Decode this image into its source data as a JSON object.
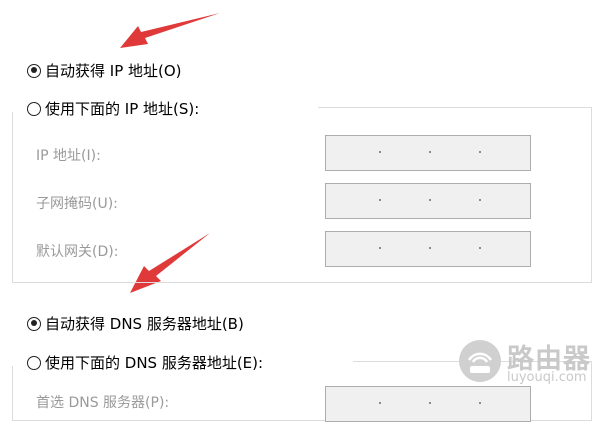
{
  "ip_section": {
    "auto_option": {
      "label": "自动获得 IP 地址(O)",
      "checked": true
    },
    "manual_option": {
      "label": "使用下面的 IP 地址(S):",
      "checked": false
    },
    "fields": [
      {
        "label": "IP 地址(I):",
        "value": ". . ."
      },
      {
        "label": "子网掩码(U):",
        "value": ". . ."
      },
      {
        "label": "默认网关(D):",
        "value": ". . ."
      }
    ]
  },
  "dns_section": {
    "auto_option": {
      "label": "自动获得 DNS 服务器地址(B)",
      "checked": true
    },
    "manual_option": {
      "label": "使用下面的 DNS 服务器地址(E):",
      "checked": false
    },
    "fields": [
      {
        "label": "首选 DNS 服务器(P):",
        "value": ". . ."
      }
    ]
  },
  "annotation": {
    "arrow_color": "#e0393a"
  },
  "watermark": {
    "name": "路由器",
    "url": "luyouqi.com"
  }
}
